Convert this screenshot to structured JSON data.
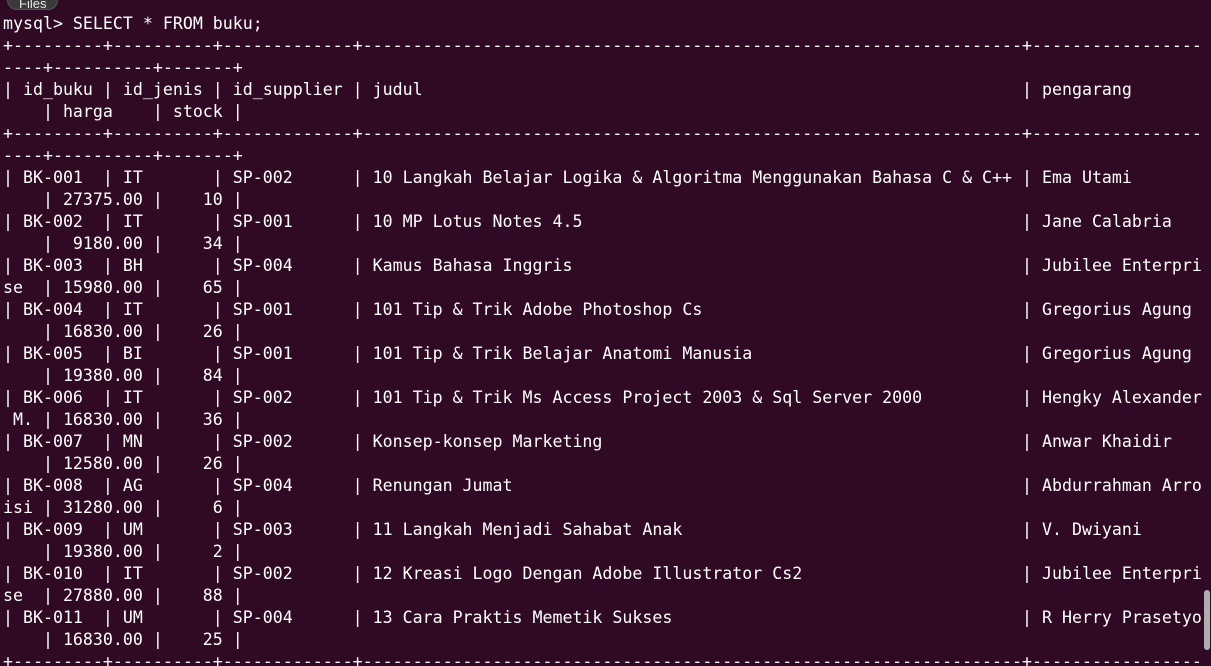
{
  "overlay": {
    "files_label": "Files"
  },
  "terminal": {
    "lines": [
      "mysql> SELECT * FROM buku;",
      "+---------+----------+-------------+------------------------------------------------------------------+-----------------",
      "----+----------+-------+",
      "| id_buku | id_jenis | id_supplier | judul                                                            | pengarang",
      "    | harga    | stock |",
      "+---------+----------+-------------+------------------------------------------------------------------+-----------------",
      "----+----------+-------+",
      "| BK-001  | IT       | SP-002      | 10 Langkah Belajar Logika & Algoritma Menggunakan Bahasa C & C++ | Ema Utami",
      "    | 27375.00 |    10 |",
      "| BK-002  | IT       | SP-001      | 10 MP Lotus Notes 4.5                                            | Jane Calabria",
      "    |  9180.00 |    34 |",
      "| BK-003  | BH       | SP-004      | Kamus Bahasa Inggris                                             | Jubilee Enterpri",
      "se  | 15980.00 |    65 |",
      "| BK-004  | IT       | SP-001      | 101 Tip & Trik Adobe Photoshop Cs                                | Gregorius Agung",
      "    | 16830.00 |    26 |",
      "| BK-005  | BI       | SP-001      | 101 Tip & Trik Belajar Anatomi Manusia                           | Gregorius Agung",
      "    | 19380.00 |    84 |",
      "| BK-006  | IT       | SP-002      | 101 Tip & Trik Ms Access Project 2003 & Sql Server 2000          | Hengky Alexander",
      " M. | 16830.00 |    36 |",
      "| BK-007  | MN       | SP-002      | Konsep-konsep Marketing                                          | Anwar Khaidir",
      "    | 12580.00 |    26 |",
      "| BK-008  | AG       | SP-004      | Renungan Jumat                                                   | Abdurrahman Arro",
      "isi | 31280.00 |     6 |",
      "| BK-009  | UM       | SP-003      | 11 Langkah Menjadi Sahabat Anak                                  | V. Dwiyani",
      "    | 19380.00 |     2 |",
      "| BK-010  | IT       | SP-002      | 12 Kreasi Logo Dengan Adobe Illustrator Cs2                      | Jubilee Enterpri",
      "se  | 27880.00 |    88 |",
      "| BK-011  | UM       | SP-004      | 13 Cara Praktis Memetik Sukses                                   | R Herry Prasetyo",
      "    | 16830.00 |    25 |",
      "+---------+----------+-------------+------------------------------------------------------------------+-----------------"
    ]
  }
}
